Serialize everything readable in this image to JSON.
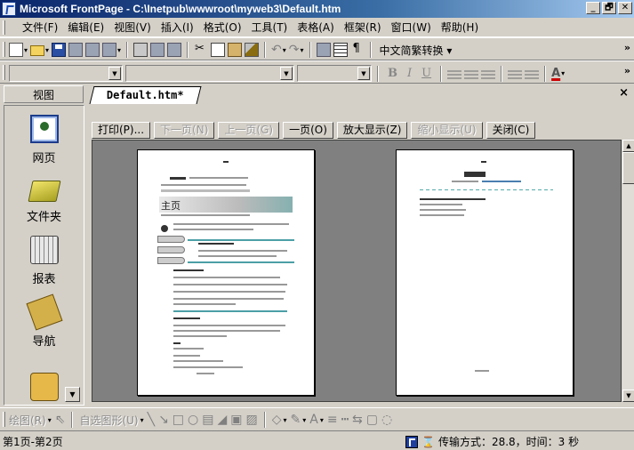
{
  "window": {
    "title": "Microsoft FrontPage - C:\\Inetpub\\wwwroot\\myweb3\\Default.htm",
    "min": "_",
    "restore": "🗗",
    "close": "✕"
  },
  "menu": [
    "文件(F)",
    "编辑(E)",
    "视图(V)",
    "插入(I)",
    "格式(O)",
    "工具(T)",
    "表格(A)",
    "框架(R)",
    "窗口(W)",
    "帮助(H)"
  ],
  "toolbar": {
    "convert_label": "中文简繁转换 ▾",
    "more": "»"
  },
  "format": {
    "bold": "B",
    "italic": "I",
    "underline": "U",
    "font_color_glyph": "A"
  },
  "views": {
    "header": "视图",
    "items": [
      {
        "label": "网页",
        "icon": "page-view-icon"
      },
      {
        "label": "文件夹",
        "icon": "folder-view-icon"
      },
      {
        "label": "报表",
        "icon": "reports-view-icon"
      },
      {
        "label": "导航",
        "icon": "navigation-view-icon"
      },
      {
        "label": "",
        "icon": "hyperlinks-view-icon"
      }
    ]
  },
  "document": {
    "tab": "Default.htm*"
  },
  "preview_toolbar": {
    "print": "打印(P)...",
    "next_page": "下一页(N)",
    "prev_page": "上一页(G)",
    "one_page": "一页(O)",
    "zoom_in": "放大显示(Z)",
    "zoom_out": "缩小显示(U)",
    "close": "关闭(C)"
  },
  "preview": {
    "page1_heading": "主页"
  },
  "drawing": {
    "draw_label": "绘图(R)",
    "autoshapes_label": "自选图形(U)"
  },
  "status": {
    "pages": "第1页-第2页",
    "transfer": "传输方式：28.8，时间：3 秒"
  }
}
